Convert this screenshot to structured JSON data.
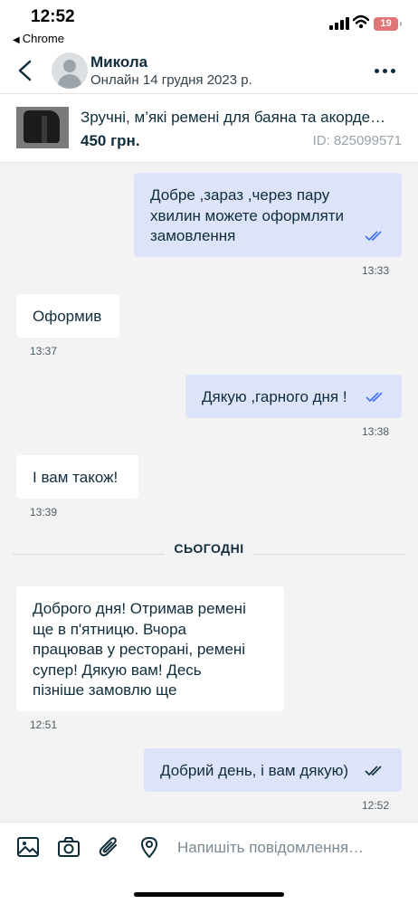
{
  "status_bar": {
    "time": "12:52",
    "back_app": "Chrome",
    "battery": "19"
  },
  "header": {
    "name": "Микола",
    "status": "Онлайн 14 грудня 2023 р."
  },
  "product": {
    "title": "Зручні, м’які ремені для баяна та акорде…",
    "price": "450 грн.",
    "id": "ID: 825099571"
  },
  "messages": [
    {
      "direction": "out",
      "lines": [
        "Добре ,зараз ,через пару",
        "хвилин можете оформляти",
        "замовлення"
      ],
      "time": "13:33",
      "read": true
    },
    {
      "direction": "in",
      "lines": [
        "Оформив"
      ],
      "time": "13:37"
    },
    {
      "direction": "out",
      "lines": [
        "Дякую ,гарного дня !"
      ],
      "time": "13:38",
      "read": true
    },
    {
      "direction": "in",
      "lines": [
        "І вам також!"
      ],
      "time": "13:39"
    },
    {
      "direction": "in",
      "lines": [
        "Доброго дня! Отримав ремені",
        "ще в п'ятницю. Вчора",
        "працював у ресторані, ремені",
        "супер! Дякую вам! Десь",
        "пізніше замовлю ще"
      ],
      "time": "12:51"
    },
    {
      "direction": "out",
      "lines": [
        "Добрий день, і вам дякую)"
      ],
      "time": "12:52",
      "read": true
    }
  ],
  "divider": {
    "label": "СЬОГОДНІ"
  },
  "composer": {
    "placeholder": "Напишіть повідомлення…"
  },
  "colors": {
    "outgoing_bubble": "#dce3fb",
    "incoming_bubble": "#ffffff",
    "read_ticks": "#3f6ef0",
    "chat_background": "#f3f3f4"
  },
  "icons": [
    "chevron-left-icon",
    "more-icon",
    "image-icon",
    "camera-icon",
    "paperclip-icon",
    "location-pin-icon",
    "double-check-icon"
  ]
}
